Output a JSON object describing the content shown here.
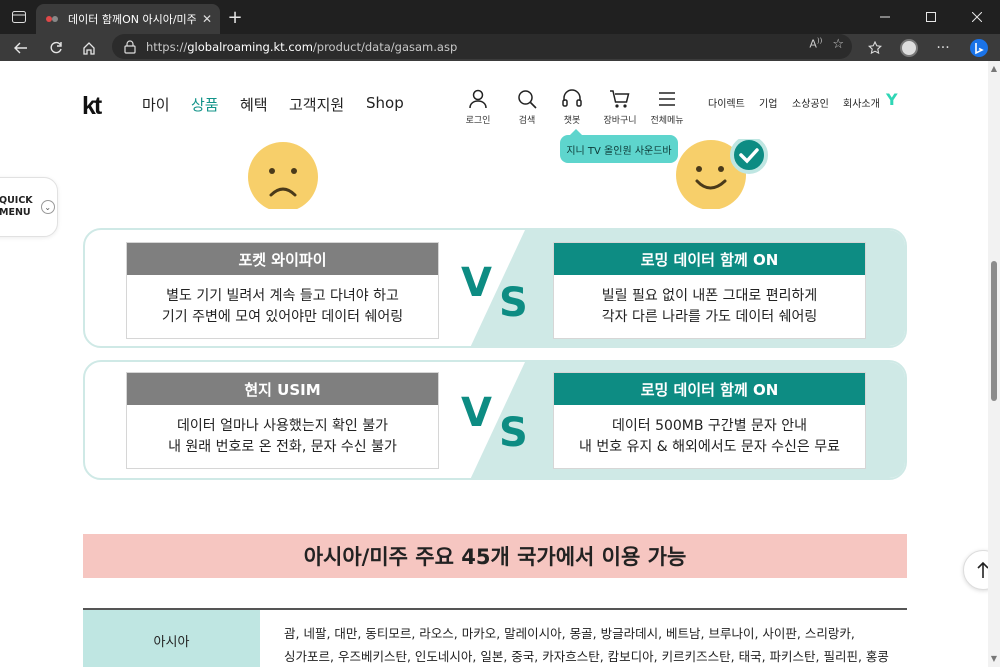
{
  "browser": {
    "tab_title": "데이터 함께ON 아시아/미주 | KT",
    "url_scheme": "https://",
    "url_host": "globalroaming.kt.com",
    "url_path": "/product/data/gasam.asp"
  },
  "site": {
    "logo": "kt",
    "gnb": [
      "마이",
      "상품",
      "혜택",
      "고객지원",
      "Shop"
    ],
    "active_gnb": "상품",
    "util": {
      "login": "로그인",
      "search": "검색",
      "chatbot": "챗봇",
      "cart": "장바구니",
      "menu": "전체메뉴"
    },
    "toplinks": [
      "다이렉트",
      "기업",
      "소상공인",
      "회사소개"
    ],
    "tooltip": "지니 TV 올인원 사운드바",
    "quick_menu": [
      "QUICK",
      "MENU"
    ]
  },
  "compare": [
    {
      "left_title": "포켓 와이파이",
      "left_lines": [
        "별도 기기 빌려서 계속 들고 다녀야 하고",
        "기기 주변에 모여 있어야만 데이터 쉐어링"
      ],
      "vs": [
        "V",
        "S"
      ],
      "right_title": "로밍 데이터 함께 ON",
      "right_lines": [
        "빌릴 필요 없이 내폰 그대로 편리하게",
        "각자 다른 나라를 가도 데이터 쉐어링"
      ]
    },
    {
      "left_title": "현지 USIM",
      "left_lines": [
        "데이터 얼마나 사용했는지 확인 불가",
        "내 원래 번호로 온 전화, 문자 수신 불가"
      ],
      "vs": [
        "V",
        "S"
      ],
      "right_title": "로밍 데이터 함께 ON",
      "right_lines": [
        "데이터 500MB 구간별 문자 안내",
        "내 번호 유지 & 해외에서도 문자 수신은 무료"
      ]
    }
  ],
  "banner": "아시아/미주 주요 45개 국가에서 이용 가능",
  "table": {
    "region": "아시아",
    "countries_line1": "괌, 네팔, 대만, 동티모르, 라오스, 마카오, 말레이시아, 몽골, 방글라데시, 베트남, 브루나이, 사이판, 스리랑카,",
    "countries_line2": "싱가포르, 우즈베키스탄, 인도네시아, 일본, 중국, 카자흐스탄, 캄보디아, 키르키즈스탄, 태국, 파키스탄, 필리핀, 홍콩"
  },
  "colors": {
    "teal": "#0d8c83",
    "brand_active": "#14948a",
    "banner_pink": "#f6c6c1",
    "panel_tint": "#cfe9e6"
  }
}
